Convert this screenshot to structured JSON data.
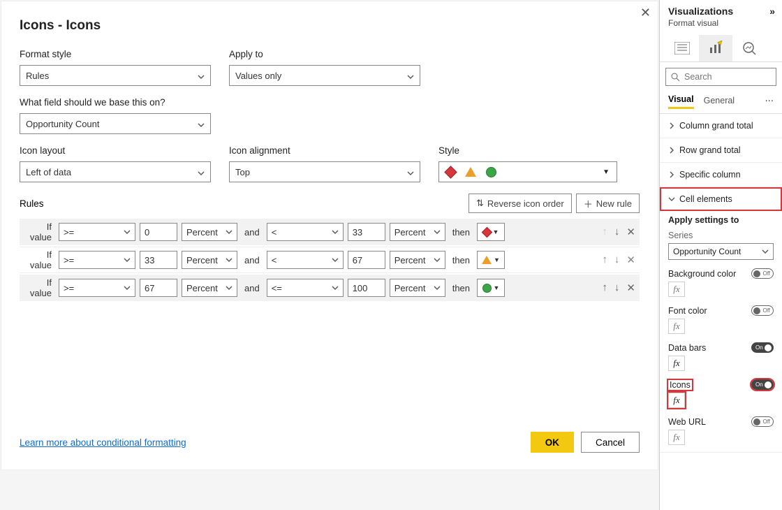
{
  "dialog": {
    "title": "Icons - Icons",
    "format_style_label": "Format style",
    "format_style_value": "Rules",
    "apply_to_label": "Apply to",
    "apply_to_value": "Values only",
    "basis_label": "What field should we base this on?",
    "basis_value": "Opportunity Count",
    "icon_layout_label": "Icon layout",
    "icon_layout_value": "Left of data",
    "icon_alignment_label": "Icon alignment",
    "icon_alignment_value": "Top",
    "style_label": "Style",
    "rules_label": "Rules",
    "reverse_btn": "Reverse icon order",
    "new_rule_btn": "New rule",
    "if_value": "If value",
    "and": "and",
    "then": "then",
    "unit": "Percent",
    "rules": [
      {
        "op1": ">=",
        "v1": "0",
        "op2": "<",
        "v2": "33",
        "shape": "diamond"
      },
      {
        "op1": ">=",
        "v1": "33",
        "op2": "<",
        "v2": "67",
        "shape": "triangle"
      },
      {
        "op1": ">=",
        "v1": "67",
        "op2": "<=",
        "v2": "100",
        "shape": "circle"
      }
    ],
    "learn_more": "Learn more about conditional formatting",
    "ok": "OK",
    "cancel": "Cancel"
  },
  "panel": {
    "title": "Visualizations",
    "subtitle": "Format visual",
    "search_placeholder": "Search",
    "tabs": {
      "visual": "Visual",
      "general": "General"
    },
    "sections": {
      "col_total": "Column grand total",
      "row_total": "Row grand total",
      "spec_col": "Specific column",
      "cell_el": "Cell elements"
    },
    "apply_settings": "Apply settings to",
    "series_label": "Series",
    "series_value": "Opportunity Count",
    "props": {
      "bg": "Background color",
      "font": "Font color",
      "bars": "Data bars",
      "icons": "Icons",
      "url": "Web URL"
    },
    "toggle_on": "On",
    "toggle_off": "Off"
  }
}
